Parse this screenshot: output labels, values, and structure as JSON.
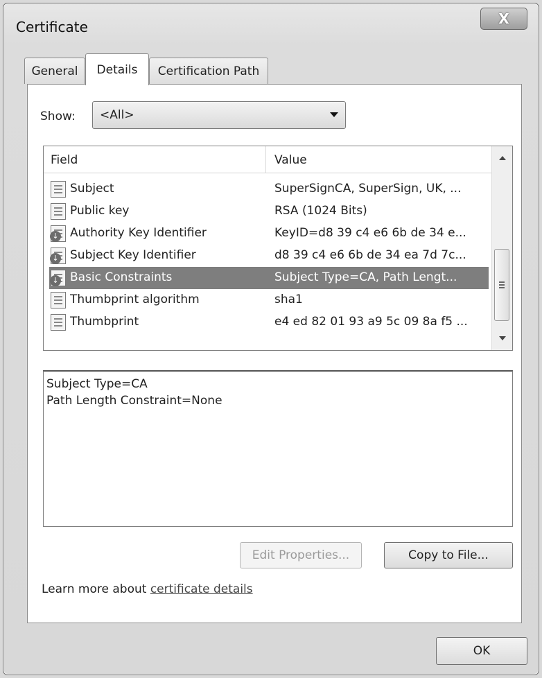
{
  "window": {
    "title": "Certificate",
    "close_label": "X"
  },
  "tabs": [
    {
      "label": "General",
      "active": false
    },
    {
      "label": "Details",
      "active": true
    },
    {
      "label": "Certification Path",
      "active": false
    }
  ],
  "show": {
    "label": "Show:",
    "selected": "<All>"
  },
  "fields": {
    "header_field": "Field",
    "header_value": "Value",
    "rows": [
      {
        "icon": "certificate-field-icon",
        "field": "Subject",
        "value": "SuperSignCA, SuperSign, UK, ..."
      },
      {
        "icon": "certificate-field-icon",
        "field": "Public key",
        "value": "RSA (1024 Bits)"
      },
      {
        "icon": "extension-field-icon",
        "field": "Authority Key Identifier",
        "value": "KeyID=d8 39 c4 e6 6b de 34 e..."
      },
      {
        "icon": "extension-field-icon",
        "field": "Subject Key Identifier",
        "value": "d8 39 c4 e6 6b de 34 ea 7d 7c..."
      },
      {
        "icon": "extension-field-icon",
        "field": "Basic Constraints",
        "value": "Subject Type=CA, Path Lengt...",
        "selected": true
      },
      {
        "icon": "certificate-field-icon",
        "field": "Thumbprint algorithm",
        "value": "sha1"
      },
      {
        "icon": "certificate-field-icon",
        "field": "Thumbprint",
        "value": "e4 ed 82 01 93 a9 5c 09 8a f5 ..."
      }
    ]
  },
  "detail": {
    "line1": "Subject Type=CA",
    "line2": "Path Length Constraint=None"
  },
  "buttons": {
    "edit_properties": "Edit Properties...",
    "copy_to_file": "Copy to File...",
    "ok": "OK"
  },
  "learn": {
    "prefix": "Learn more about ",
    "link": "certificate details"
  },
  "colors": {
    "selection": "#7e7e7e"
  }
}
